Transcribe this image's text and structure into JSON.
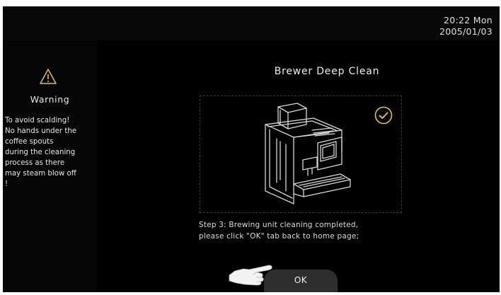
{
  "status_bar": {
    "time": "20:22  Mon",
    "date": "2005/01/03"
  },
  "warning": {
    "icon": "warning-triangle-icon",
    "title": "Warning",
    "lines": [
      "To avoid scalding!",
      "No hands under the",
      "coffee spouts",
      "during the cleaning",
      "process as there",
      "may steam blow off",
      "!"
    ]
  },
  "main": {
    "title": "Brewer Deep Clean",
    "illustration": "coffee-machine-illustration",
    "status_icon": "checkmark-icon",
    "step_lines": [
      "Step 3: Brewing unit  cleaning completed,",
      "please click \"OK\" tab back to home page;"
    ],
    "ok_label": "OK",
    "pointer_icon": "pointing-hand-icon"
  },
  "colors": {
    "background": "#000000",
    "text": "#e8e8e8",
    "accent": "#e6c23a",
    "button": "#2e2e2e"
  }
}
